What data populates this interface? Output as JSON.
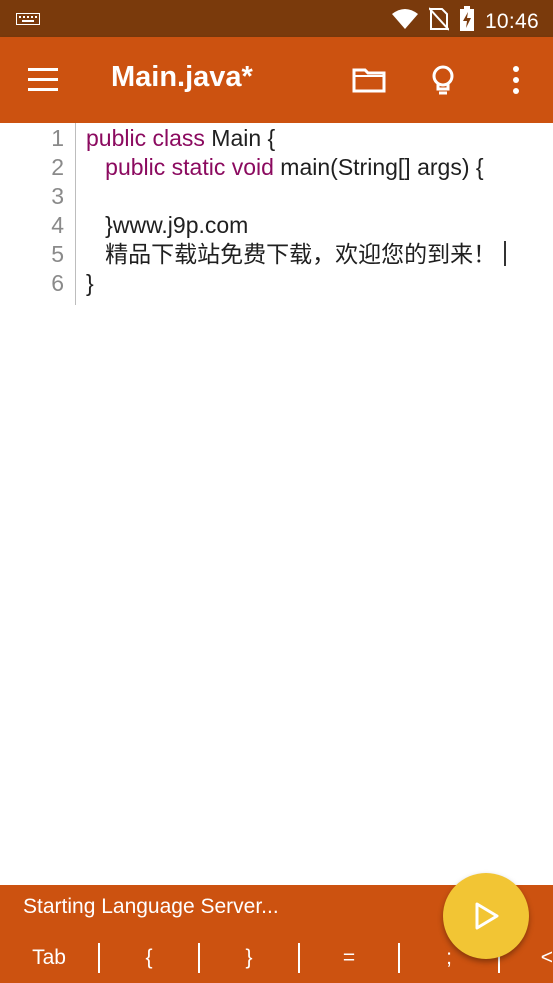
{
  "status_bar": {
    "time": "10:46",
    "icons": [
      "keyboard-icon",
      "wifi-icon",
      "no-sim-icon",
      "battery-charging-icon"
    ]
  },
  "app_bar": {
    "title": "Main.java*",
    "icons": [
      "menu-icon",
      "folder-icon",
      "lightbulb-icon",
      "more-vert-icon"
    ]
  },
  "editor": {
    "lines": [
      {
        "num": "1",
        "kw": "public class",
        "text": " Main {"
      },
      {
        "num": "2",
        "indent": "   ",
        "kw": "public static void",
        "text": " main(String[] args) {"
      },
      {
        "num": "3",
        "text": ""
      },
      {
        "num": "4",
        "text": "   }www.j9p.com"
      },
      {
        "num": "5",
        "text": "   精品下载站免费下载，欢迎您的到来！"
      },
      {
        "num": "6",
        "text": "}"
      }
    ]
  },
  "bottom_bar": {
    "status": "Starting Language Server...",
    "keys": [
      "Tab",
      "{",
      "}",
      "=",
      ";",
      "<"
    ]
  },
  "fab": {
    "icon": "play-icon"
  },
  "colors": {
    "status_bar_bg": "#7a3a0c",
    "accent": "#cc5210",
    "keyword": "#8b0a5f",
    "fab": "#f2c534"
  }
}
